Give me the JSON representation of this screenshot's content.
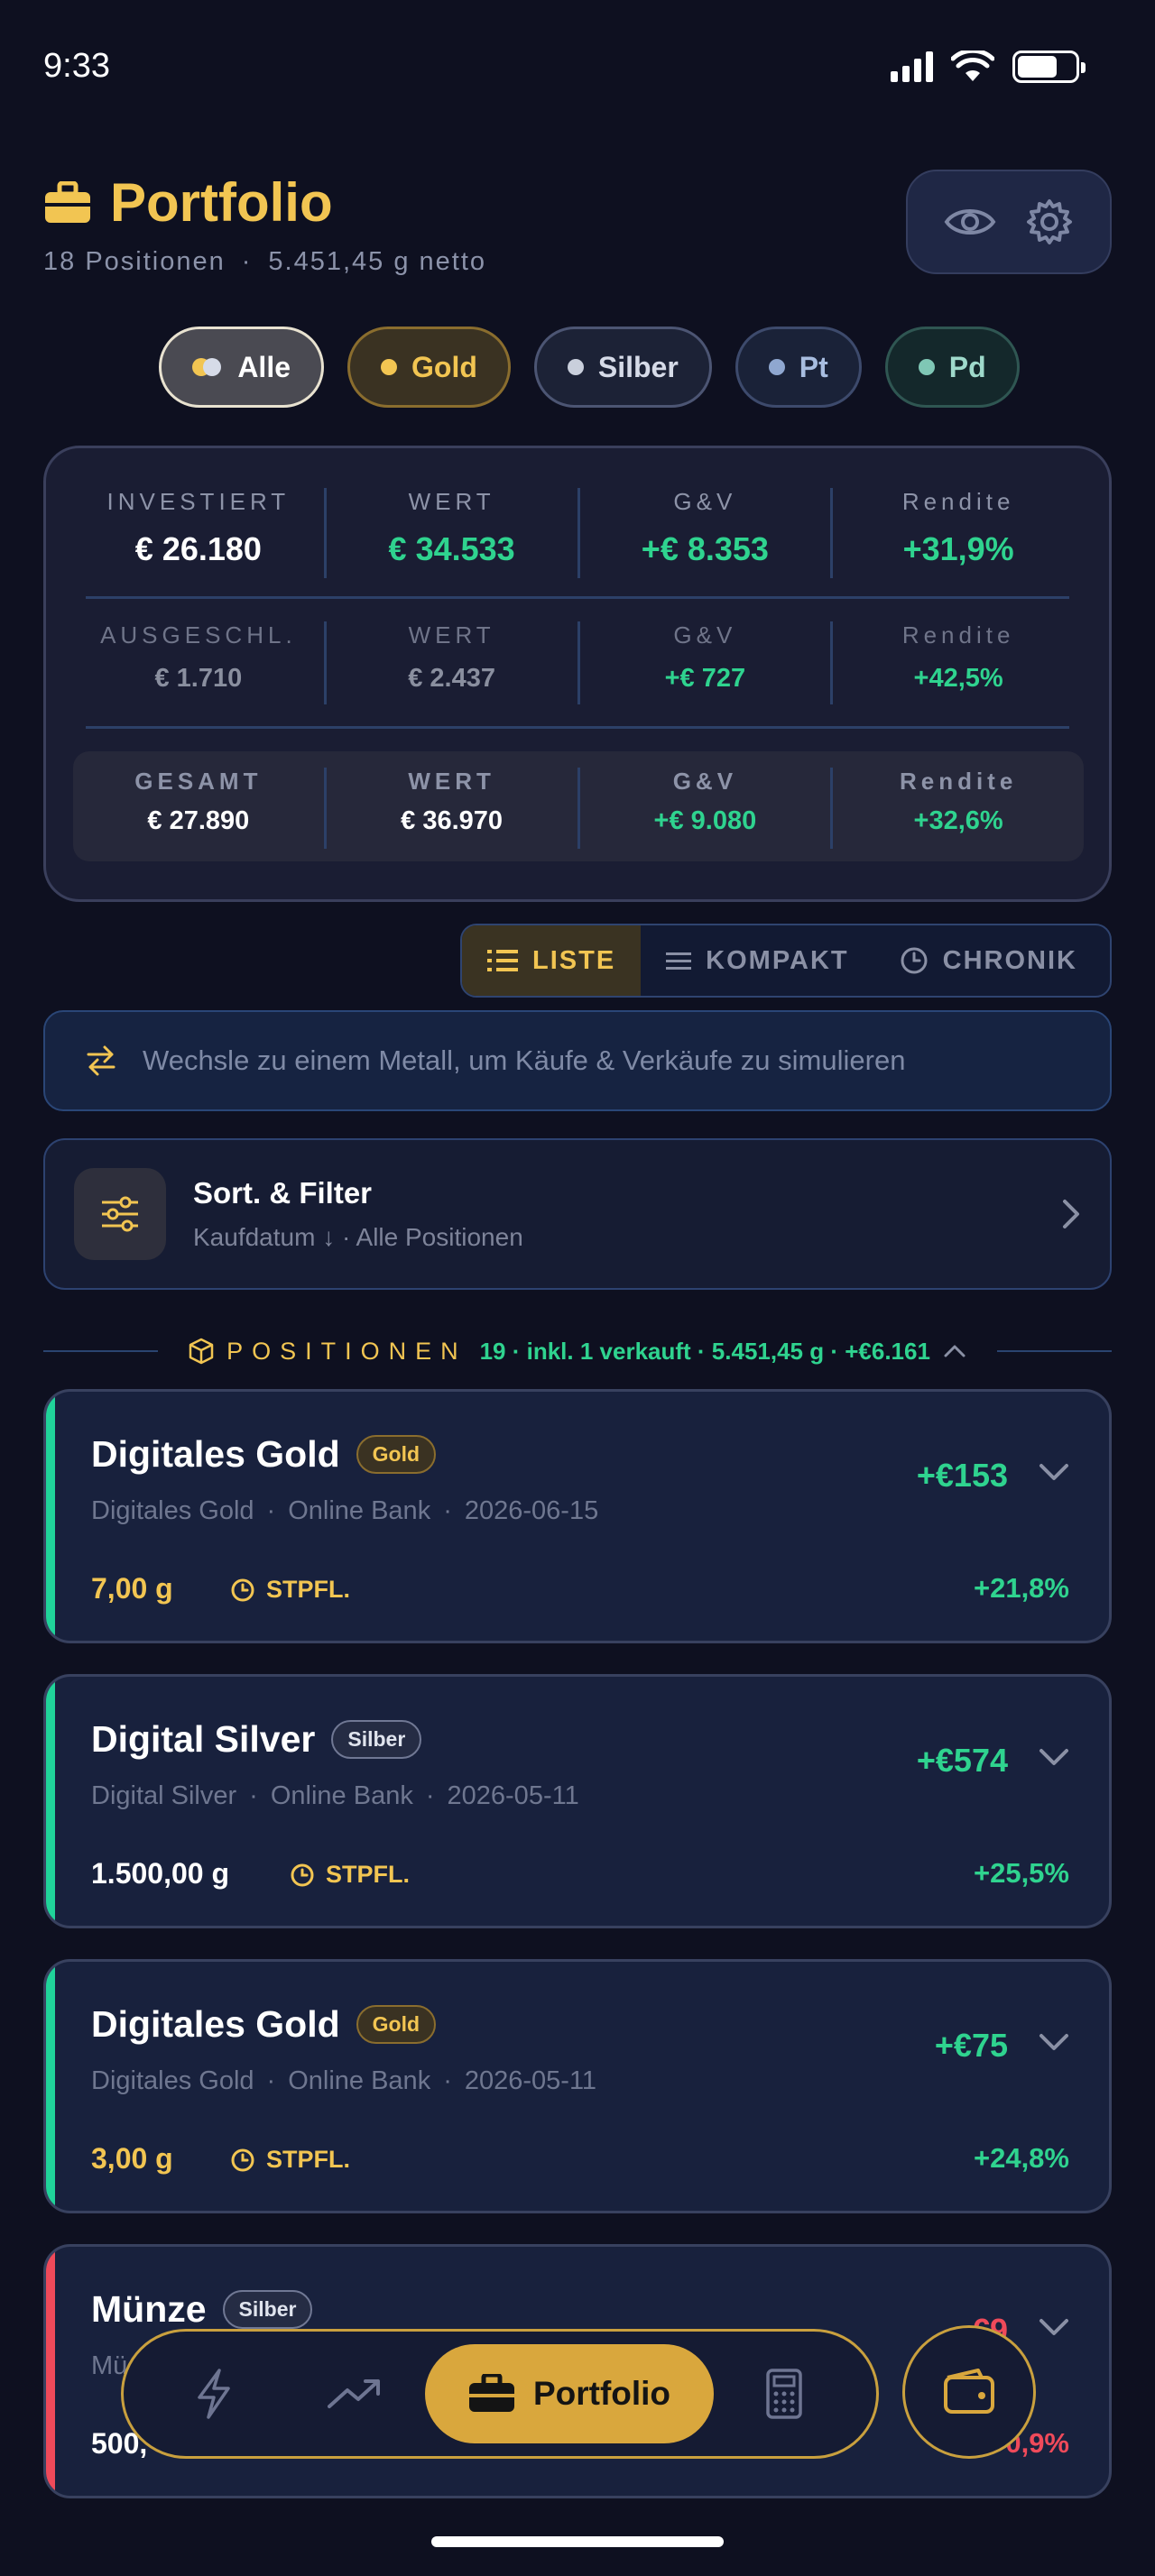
{
  "status": {
    "time": "9:33"
  },
  "header": {
    "title": "Portfolio",
    "positions_count": "18 Positionen",
    "net_weight": "5.451,45 g netto"
  },
  "filters": [
    {
      "label": "Alle",
      "active": true
    },
    {
      "label": "Gold"
    },
    {
      "label": "Silber"
    },
    {
      "label": "Pt"
    },
    {
      "label": "Pd"
    }
  ],
  "summary": {
    "row1": [
      {
        "label": "INVESTIERT",
        "value": "€ 26.180"
      },
      {
        "label": "WERT",
        "value": "€ 34.533"
      },
      {
        "label": "G&V",
        "value": "+€ 8.353"
      },
      {
        "label": "Rendite",
        "value": "+31,9%"
      }
    ],
    "row2": [
      {
        "label": "AUSGESCHL.",
        "value": "€ 1.710"
      },
      {
        "label": "WERT",
        "value": "€ 2.437"
      },
      {
        "label": "G&V",
        "value": "+€ 727"
      },
      {
        "label": "Rendite",
        "value": "+42,5%"
      }
    ],
    "row3": [
      {
        "label": "GESAMT",
        "value": "€ 27.890"
      },
      {
        "label": "WERT",
        "value": "€ 36.970"
      },
      {
        "label": "G&V",
        "value": "+€ 9.080"
      },
      {
        "label": "Rendite",
        "value": "+32,6%"
      }
    ]
  },
  "views": [
    {
      "label": "LISTE",
      "active": true
    },
    {
      "label": "KOMPAKT"
    },
    {
      "label": "CHRONIK"
    }
  ],
  "banner": {
    "text": "Wechsle zu einem Metall, um Käufe & Verkäufe zu simulieren"
  },
  "sort_filter": {
    "title": "Sort. & Filter",
    "subtitle": "Kaufdatum ↓ · Alle Positionen"
  },
  "positions_header": {
    "label": "POSITIONEN",
    "meta": "19 · inkl. 1 verkauft · 5.451,45 g · +€6.161"
  },
  "positions": [
    {
      "name": "Digitales Gold",
      "badge": "Gold",
      "product": "Digitales Gold",
      "dealer": "Online Bank",
      "date": "2026-06-15",
      "gain": "+€153",
      "qty": "7,00 g",
      "tax": "STPFL.",
      "pct": "+21,8%"
    },
    {
      "name": "Digital Silver",
      "badge": "Silber",
      "product": "Digital Silver",
      "dealer": "Online Bank",
      "date": "2026-05-11",
      "gain": "+€574",
      "qty": "1.500,00 g",
      "tax": "STPFL.",
      "pct": "+25,5%"
    },
    {
      "name": "Digitales Gold",
      "badge": "Gold",
      "product": "Digitales Gold",
      "dealer": "Online Bank",
      "date": "2026-05-11",
      "gain": "+€75",
      "qty": "3,00 g",
      "tax": "STPFL.",
      "pct": "+24,8%"
    },
    {
      "name": "Münze",
      "badge": "Silber",
      "product": "Mü",
      "gain": "-€9",
      "qty": "500,",
      "pct": "-0,9%"
    }
  ],
  "nav": {
    "active_label": "Portfolio"
  },
  "colors": {
    "accent_gold": "#f2c552",
    "positive": "#2fd38f",
    "negative": "#ef4a5a",
    "background": "#0e1020"
  }
}
